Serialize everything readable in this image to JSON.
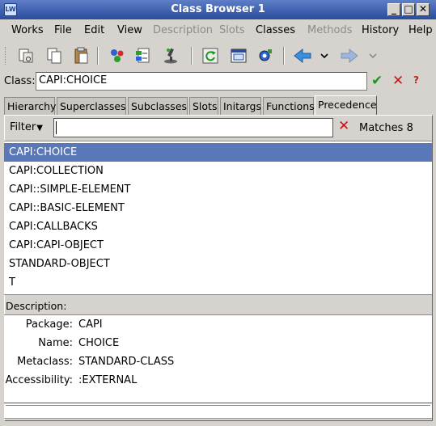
{
  "window": {
    "title": "Class Browser 1",
    "icon_text": "LW"
  },
  "menubar": {
    "items": [
      {
        "label": "Works",
        "disabled": false
      },
      {
        "label": "File",
        "disabled": false
      },
      {
        "label": "Edit",
        "disabled": false
      },
      {
        "label": "View",
        "disabled": false
      },
      {
        "label": "Description",
        "disabled": true
      },
      {
        "label": "Slots",
        "disabled": true
      },
      {
        "label": "Classes",
        "disabled": false
      },
      {
        "label": "Methods",
        "disabled": true
      },
      {
        "label": "History",
        "disabled": false
      },
      {
        "label": "Help",
        "disabled": false
      }
    ]
  },
  "classrow": {
    "label": "Class:",
    "value": "CAPI:CHOICE"
  },
  "tabs": [
    {
      "label": "Hierarchy"
    },
    {
      "label": "Superclasses"
    },
    {
      "label": "Subclasses"
    },
    {
      "label": "Slots"
    },
    {
      "label": "Initargs"
    },
    {
      "label": "Functions"
    },
    {
      "label": "Precedence",
      "active": true
    }
  ],
  "filter": {
    "label": "Filter",
    "value": "",
    "matches": "Matches 8"
  },
  "precedence_list": [
    "CAPI:CHOICE",
    "CAPI:COLLECTION",
    "CAPI::SIMPLE-ELEMENT",
    "CAPI::BASIC-ELEMENT",
    "CAPI:CALLBACKS",
    "CAPI:CAPI-OBJECT",
    "STANDARD-OBJECT",
    "T"
  ],
  "selected_index": 0,
  "description": {
    "header": "Description:",
    "fields": [
      {
        "label": "Package:",
        "value": "CAPI"
      },
      {
        "label": "Name:",
        "value": "CHOICE"
      },
      {
        "label": "Metaclass:",
        "value": "STANDARD-CLASS"
      },
      {
        "label": "Accessibility:",
        "value": ":EXTERNAL"
      }
    ]
  },
  "colors": {
    "selection": "#5a78b7",
    "titlebar": "#2a4b9b",
    "accept": "#1a9a1a",
    "cancel": "#d01010"
  }
}
